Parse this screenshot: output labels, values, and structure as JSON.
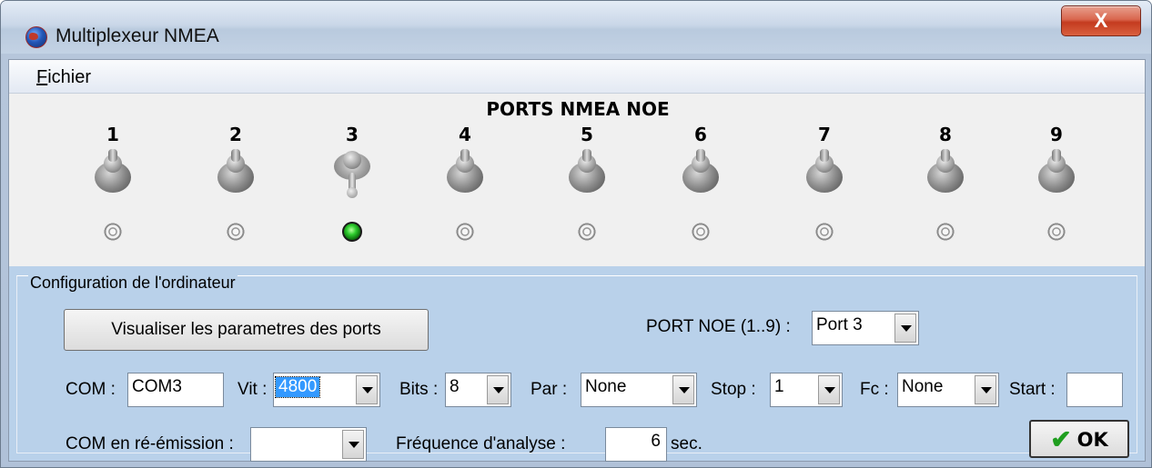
{
  "window": {
    "title": "Multiplexeur NMEA",
    "close_symbol": "X"
  },
  "menu": {
    "items": [
      {
        "label_underlined": "F",
        "label_rest": "ichier"
      }
    ]
  },
  "ports": {
    "title": "PORTS NMEA NOE",
    "items": [
      {
        "number": "1",
        "toggle_on": false,
        "led_on": false
      },
      {
        "number": "2",
        "toggle_on": false,
        "led_on": false
      },
      {
        "number": "3",
        "toggle_on": true,
        "led_on": true
      },
      {
        "number": "4",
        "toggle_on": false,
        "led_on": false
      },
      {
        "number": "5",
        "toggle_on": false,
        "led_on": false
      },
      {
        "number": "6",
        "toggle_on": false,
        "led_on": false
      },
      {
        "number": "7",
        "toggle_on": false,
        "led_on": false
      },
      {
        "number": "8",
        "toggle_on": false,
        "led_on": false
      },
      {
        "number": "9",
        "toggle_on": false,
        "led_on": false
      }
    ],
    "led_on_color": "#2ecc2e"
  },
  "config": {
    "group_label": "Configuration de l'ordinateur",
    "view_button": "Visualiser les parametres des ports",
    "port_noe_label": "PORT NOE (1..9) :",
    "port_noe_value": "Port 3",
    "com_label": "COM :",
    "com_value": "COM3",
    "vit_label": "Vit :",
    "vit_value": "4800",
    "bits_label": "Bits :",
    "bits_value": "8",
    "par_label": "Par :",
    "par_value": "None",
    "stop_label": "Stop :",
    "stop_value": "1",
    "fc_label": "Fc :",
    "fc_value": "None",
    "start_label": "Start :",
    "start_value": "",
    "reemission_label": "COM en ré-émission :",
    "reemission_value": "",
    "freq_label": "Fréquence  d'analyse :",
    "freq_value": "6",
    "freq_unit": "sec.",
    "ok_label": "OK"
  },
  "colors": {
    "config_bg": "#b9d1ea",
    "title_close": "#c43b1f",
    "selection": "#3399ff"
  }
}
